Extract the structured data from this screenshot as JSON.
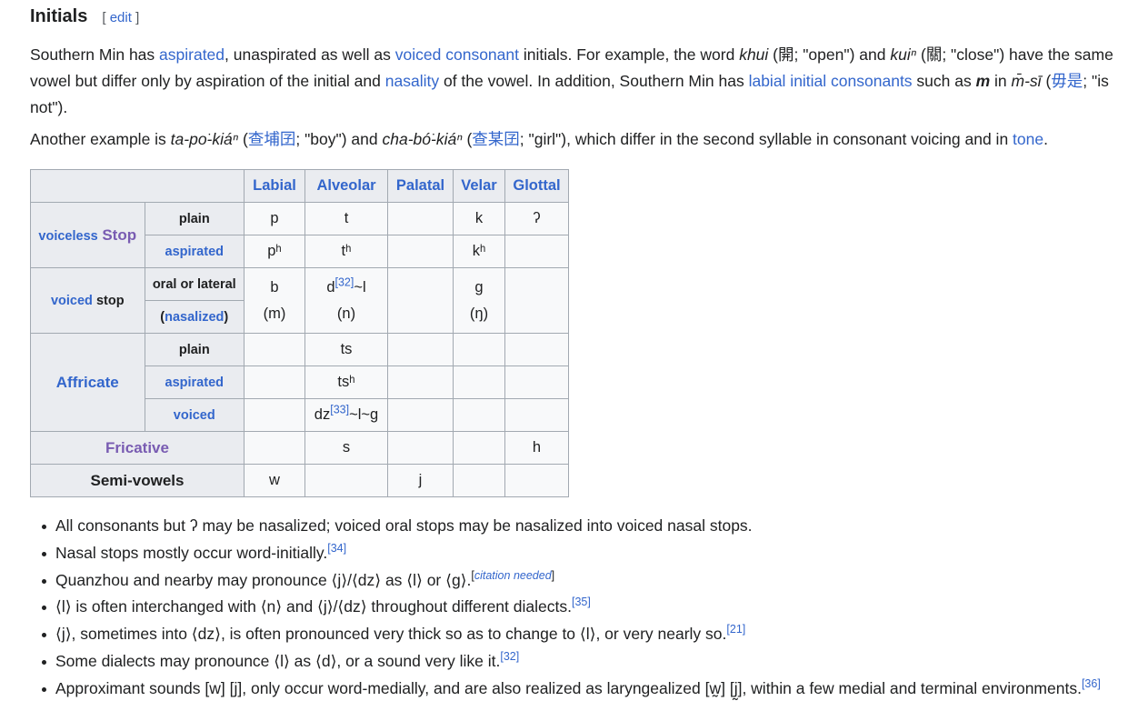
{
  "heading": {
    "title": "Initials",
    "edit_open": "[",
    "edit_label": "edit",
    "edit_close": "]"
  },
  "p1": {
    "t1": "Southern Min has ",
    "l1": "aspirated",
    "t2": ", unaspirated as well as ",
    "l2": "voiced consonant",
    "t3": " initials. For example, the word ",
    "w1": "khui",
    "t4": " (",
    "h1": "開",
    "t5": "; \"open\") and ",
    "w2": "kuiⁿ",
    "t6": " (",
    "h2": "關",
    "t7": "; \"close\") have the same vowel but differ only by aspiration of the initial and ",
    "l3": "nasality",
    "t8": " of the vowel. In addition, Southern Min has ",
    "l4": "labial initial consonants",
    "t9": " such as ",
    "m": "m",
    "t10": " in ",
    "w3": "m̄-sī",
    "t11": " (",
    "l5": "毋是",
    "t12": "; \"is not\")."
  },
  "p2": {
    "t1": "Another example is ",
    "w1": "ta-po͘-kiáⁿ",
    "t2": " (",
    "l1": "查埔囝",
    "t3": "; \"boy\") and ",
    "w2": "cha-bó͘-kiáⁿ",
    "t4": " (",
    "l2": "查某囝",
    "t5": "; \"girl\"), which differ in the second syllable in consonant voicing and in ",
    "l3": "tone",
    "t6": "."
  },
  "table": {
    "headers": [
      "Labial",
      "Alveolar",
      "Palatal",
      "Velar",
      "Glottal"
    ],
    "voiceless_a": "voiceless",
    "voiceless_b": "Stop",
    "voiced_a": "voiced",
    "voiced_b": "stop",
    "affricate": "Affricate",
    "fricative": "Fricative",
    "semivowels": "Semi-vowels",
    "sub": {
      "plain": "plain",
      "aspirated": "aspirated",
      "oral": "oral or lateral",
      "nasalized_open": "(",
      "nasalized": "nasalized",
      "nasalized_close": ")",
      "plain2": "plain",
      "aspirated2": "aspirated",
      "voiced": "voiced"
    },
    "cells": {
      "vl_plain": [
        "p",
        "t",
        "",
        "k",
        "ʔ"
      ],
      "vl_asp": [
        "pʰ",
        "tʰ",
        "",
        "kʰ",
        ""
      ],
      "vd_labial_a": "b",
      "vd_labial_b": "(m)",
      "vd_alv_a_pre": "d",
      "vd_alv_a_ref": "[32]",
      "vd_alv_a_post": "~l",
      "vd_alv_b": "(n)",
      "vd_velar_a": "g",
      "vd_velar_b": "(ŋ)",
      "af_plain": "ts",
      "af_asp": "tsʰ",
      "af_voiced_pre": "dz",
      "af_voiced_ref": "[33]",
      "af_voiced_post": "~l~g",
      "fr_alv": "s",
      "fr_glottal": "h",
      "sv_labial": "w",
      "sv_palatal": "j"
    }
  },
  "notes": [
    {
      "text": "All consonants but ʔ may be nasalized; voiced oral stops may be nasalized into voiced nasal stops.",
      "ref": ""
    },
    {
      "text": "Nasal stops mostly occur word-initially.",
      "ref": "[34]"
    },
    {
      "text": "Quanzhou and nearby may pronounce ⟨j⟩/⟨dz⟩ as ⟨l⟩ or ⟨g⟩.",
      "ref": ""
    },
    {
      "text": "⟨l⟩ is often interchanged with ⟨n⟩ and ⟨j⟩/⟨dz⟩ throughout different dialects.",
      "ref": "[35]"
    },
    {
      "text": "⟨j⟩, sometimes into ⟨dz⟩, is often pronounced very thick so as to change to ⟨l⟩, or very nearly so.",
      "ref": "[21]"
    },
    {
      "text": "Some dialects may pronounce ⟨l⟩ as ⟨d⟩, or a sound very like it.",
      "ref": "[32]"
    },
    {
      "text": "Approximant sounds [w] [j], only occur word-medially, and are also realized as laryngealized [w̰] [j̰], within a few medial and terminal environments.",
      "ref": "[36]"
    }
  ],
  "citation": {
    "open": "[",
    "label": "citation needed",
    "close": "]"
  }
}
